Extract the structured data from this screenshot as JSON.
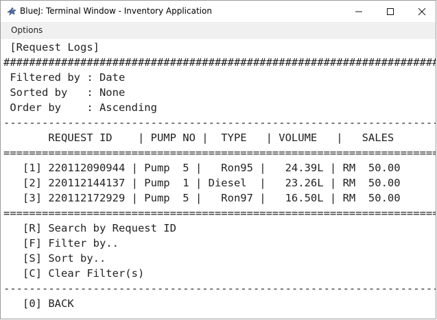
{
  "window": {
    "title": "BlueJ: Terminal Window - Inventory Application"
  },
  "menu": {
    "options_label": "Options"
  },
  "terminal": {
    "header": " [Request Logs]",
    "hash_rule": "################################################################################",
    "filter_line": " Filtered by : Date",
    "sort_line": " Sorted by   : None",
    "order_line": " Order by    : Ascending",
    "dash_rule": "--------------------------------------------------------------------------------",
    "table_header": "       REQUEST ID    | PUMP NO |  TYPE   | VOLUME   |   SALES",
    "eq_rule": "================================================================================",
    "rows": [
      "   [1] 220112090944 | Pump  5 |   Ron95 |   24.39L | RM  50.00",
      "   [2] 220112144137 | Pump  1 | Diesel  |   23.26L | RM  50.00",
      "   [3] 220112172929 | Pump  5 |   Ron97 |   16.50L | RM  50.00"
    ],
    "options": [
      "   [R] Search by Request ID",
      "   [F] Filter by..",
      "   [S] Sort by..",
      "   [C] Clear Filter(s)"
    ],
    "back": "   [0] BACK"
  }
}
